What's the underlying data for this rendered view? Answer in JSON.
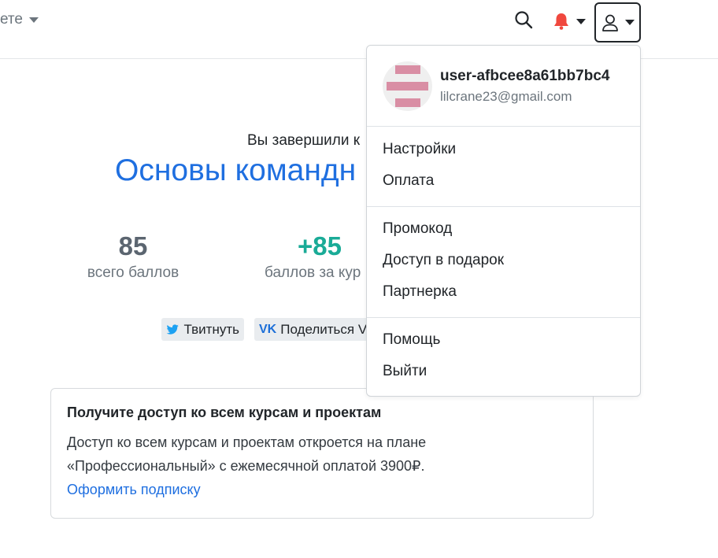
{
  "navbar": {
    "left_menu_label": "ете",
    "search_icon": "search-icon",
    "bell_icon": "bell-icon",
    "bell_color": "#f0483e",
    "user_icon": "user-icon"
  },
  "main": {
    "completed_text": "Вы завершили к",
    "course_title": "Основы командн",
    "stats": {
      "total_value": "85",
      "total_label": "всего баллов",
      "course_value": "+85",
      "course_label": "баллов за кур"
    },
    "share": {
      "tweet_label": "Твитнуть",
      "vk_logo": "VK",
      "vk_label": "Поделиться VI"
    },
    "promo": {
      "title": "Получите доступ ко всем курсам и проектам",
      "text_line1": "Доступ ко всем курсам и проектам откроется на плане",
      "text_line2": "«Профессиональный» с ежемесячной оплатой 3900₽.",
      "link": "Оформить подписку"
    }
  },
  "dropdown": {
    "username": "user-afbcee8a61bb7bc4",
    "email": "lilcrane23@gmail.com",
    "group1": [
      "Настройки",
      "Оплата"
    ],
    "group2": [
      "Промокод",
      "Доступ в подарок",
      "Партнерка"
    ],
    "group3": [
      "Помощь",
      "Выйти"
    ]
  },
  "colors": {
    "accent": "#1f6fe0",
    "success": "#1aab97",
    "avatar_pattern": "#d98ea4"
  }
}
